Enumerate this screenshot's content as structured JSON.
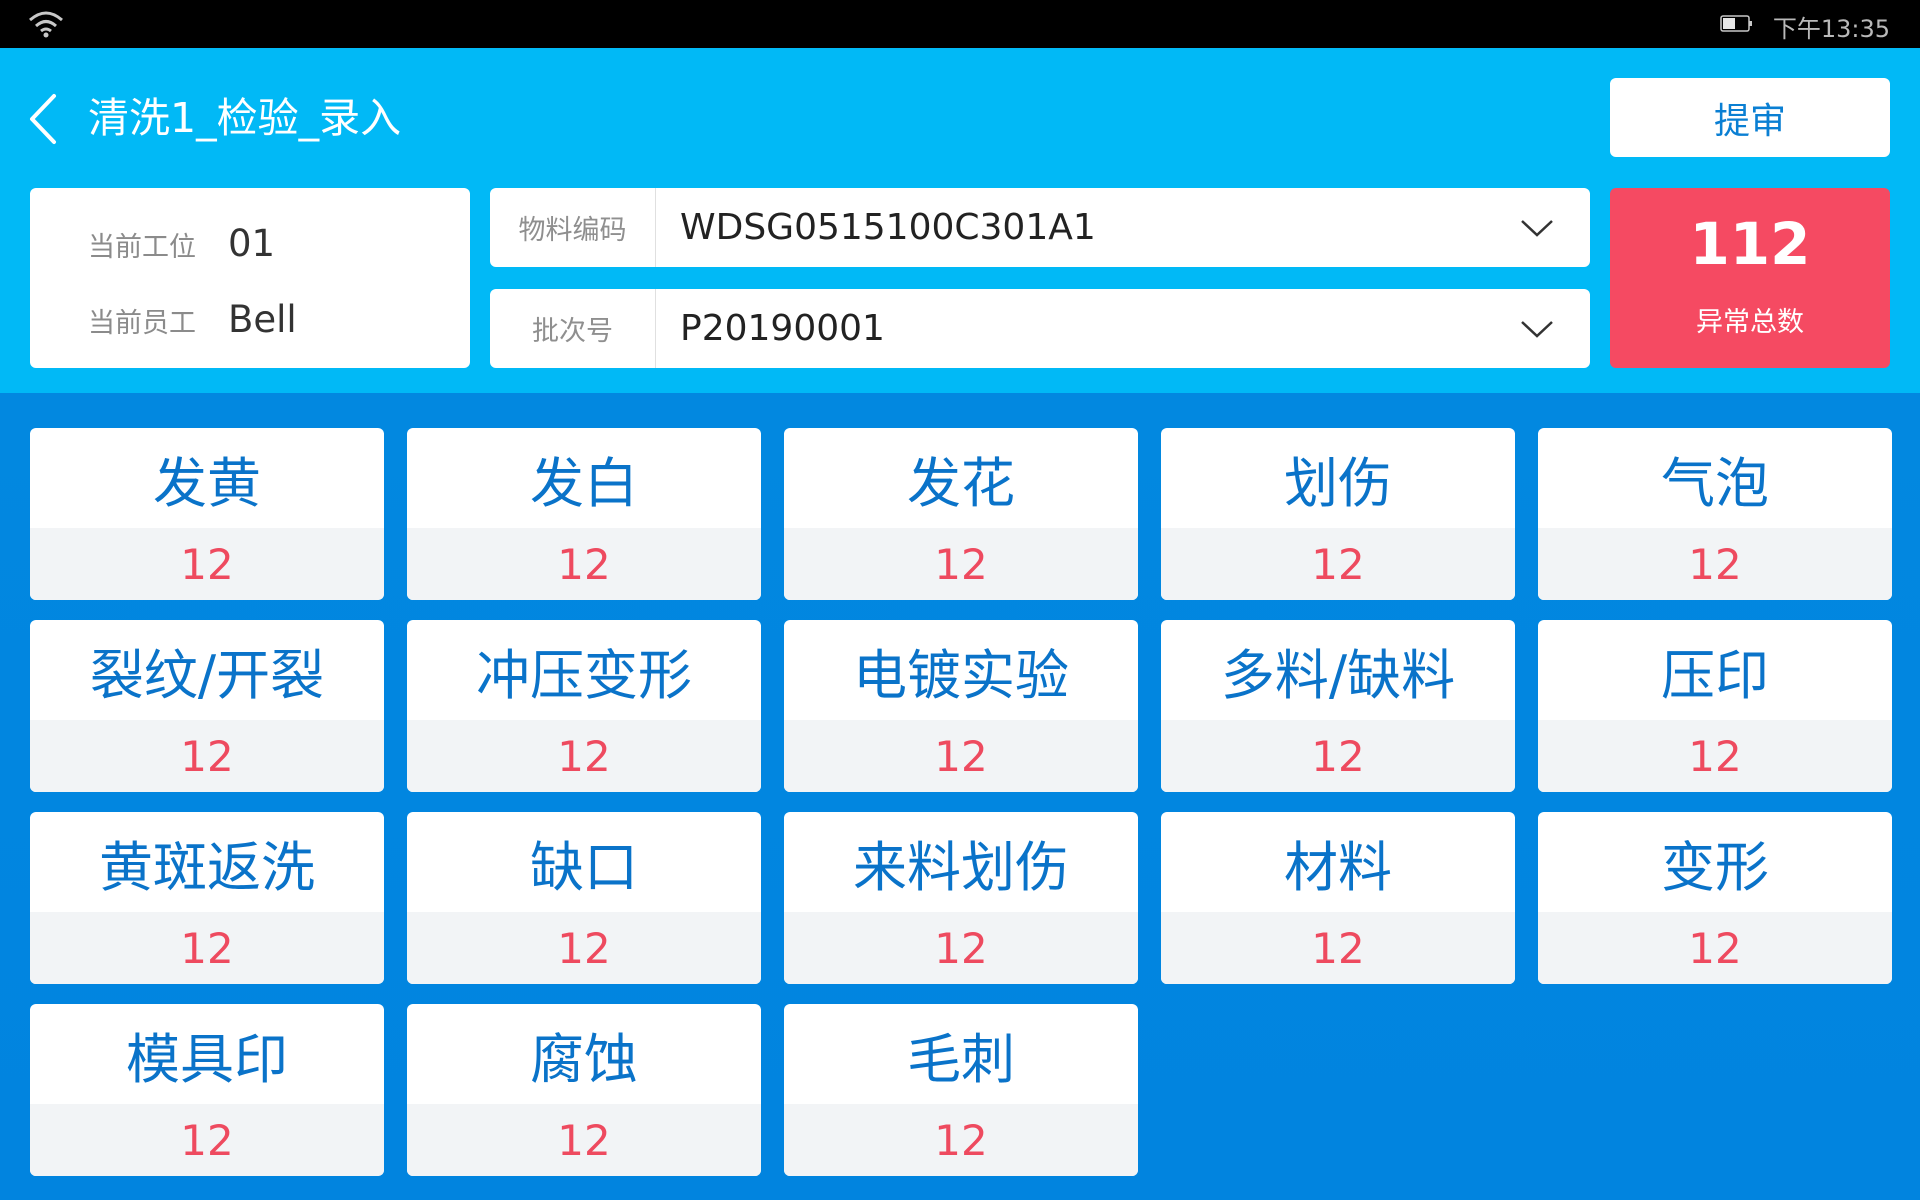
{
  "statusbar": {
    "time": "下午13:35",
    "icons": [
      "wifi-icon",
      "battery-icon"
    ]
  },
  "header": {
    "title": "清洗1_检验_录入",
    "submit_label": "提审"
  },
  "info": {
    "station_label": "当前工位",
    "station_value": "01",
    "employee_label": "当前员工",
    "employee_value": "Bell"
  },
  "fields": {
    "material_label": "物料编码",
    "material_value": "WDSG0515100C301A1",
    "batch_label": "批次号",
    "batch_value": "P20190001"
  },
  "total": {
    "count": "112",
    "label": "异常总数"
  },
  "defects": [
    {
      "name": "发黄",
      "count": "12"
    },
    {
      "name": "发白",
      "count": "12"
    },
    {
      "name": "发花",
      "count": "12"
    },
    {
      "name": "划伤",
      "count": "12"
    },
    {
      "name": "气泡",
      "count": "12"
    },
    {
      "name": "裂纹/开裂",
      "count": "12"
    },
    {
      "name": "冲压变形",
      "count": "12"
    },
    {
      "name": "电镀实验",
      "count": "12"
    },
    {
      "name": "多料/缺料",
      "count": "12"
    },
    {
      "name": "压印",
      "count": "12"
    },
    {
      "name": "黄斑返洗",
      "count": "12"
    },
    {
      "name": "缺口",
      "count": "12"
    },
    {
      "name": "来料划伤",
      "count": "12"
    },
    {
      "name": "材料",
      "count": "12"
    },
    {
      "name": "变形",
      "count": "12"
    },
    {
      "name": "模具印",
      "count": "12"
    },
    {
      "name": "腐蚀",
      "count": "12"
    },
    {
      "name": "毛刺",
      "count": "12"
    }
  ],
  "colors": {
    "header_bg": "#01b9f6",
    "content_bg": "#0283de",
    "total_bg": "#f54a62",
    "defect_name": "#0a73c9",
    "defect_count": "#ee4a5f"
  }
}
